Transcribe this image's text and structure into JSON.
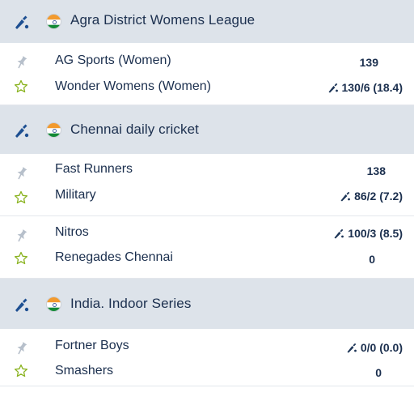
{
  "leagues": [
    {
      "title": "Agra District Womens League",
      "matches": [
        {
          "team1": "AG Sports (Women)",
          "score1": "139",
          "team2": "Wonder Womens (Women)",
          "score2": "130/6 (18.4)",
          "batting": 2
        }
      ]
    },
    {
      "title": "Chennai daily cricket",
      "matches": [
        {
          "team1": "Fast Runners",
          "score1": "138",
          "team2": "Military",
          "score2": "86/2 (7.2)",
          "batting": 2
        },
        {
          "team1": "Nitros",
          "score1": "100/3 (8.5)",
          "team2": "Renegades Chennai",
          "score2": "0",
          "batting": 1
        }
      ]
    },
    {
      "title": "India. Indoor Series",
      "matches": [
        {
          "team1": "Fortner Boys",
          "score1": "0/0 (0.0)",
          "team2": "Smashers",
          "score2": "0",
          "batting": 1
        }
      ]
    }
  ],
  "icons": {
    "sport": "cricket-bat-icon",
    "flag": "india-flag-icon",
    "pin": "pin-icon",
    "favorite": "star-icon",
    "batting": "cricket-bat-icon"
  },
  "colors": {
    "header_bg": "#dde3ea",
    "text": "#1b2f4e",
    "accent_blue": "#1d63c7",
    "pin_grey": "#b7c0cb",
    "star_green": "#8ab320"
  }
}
